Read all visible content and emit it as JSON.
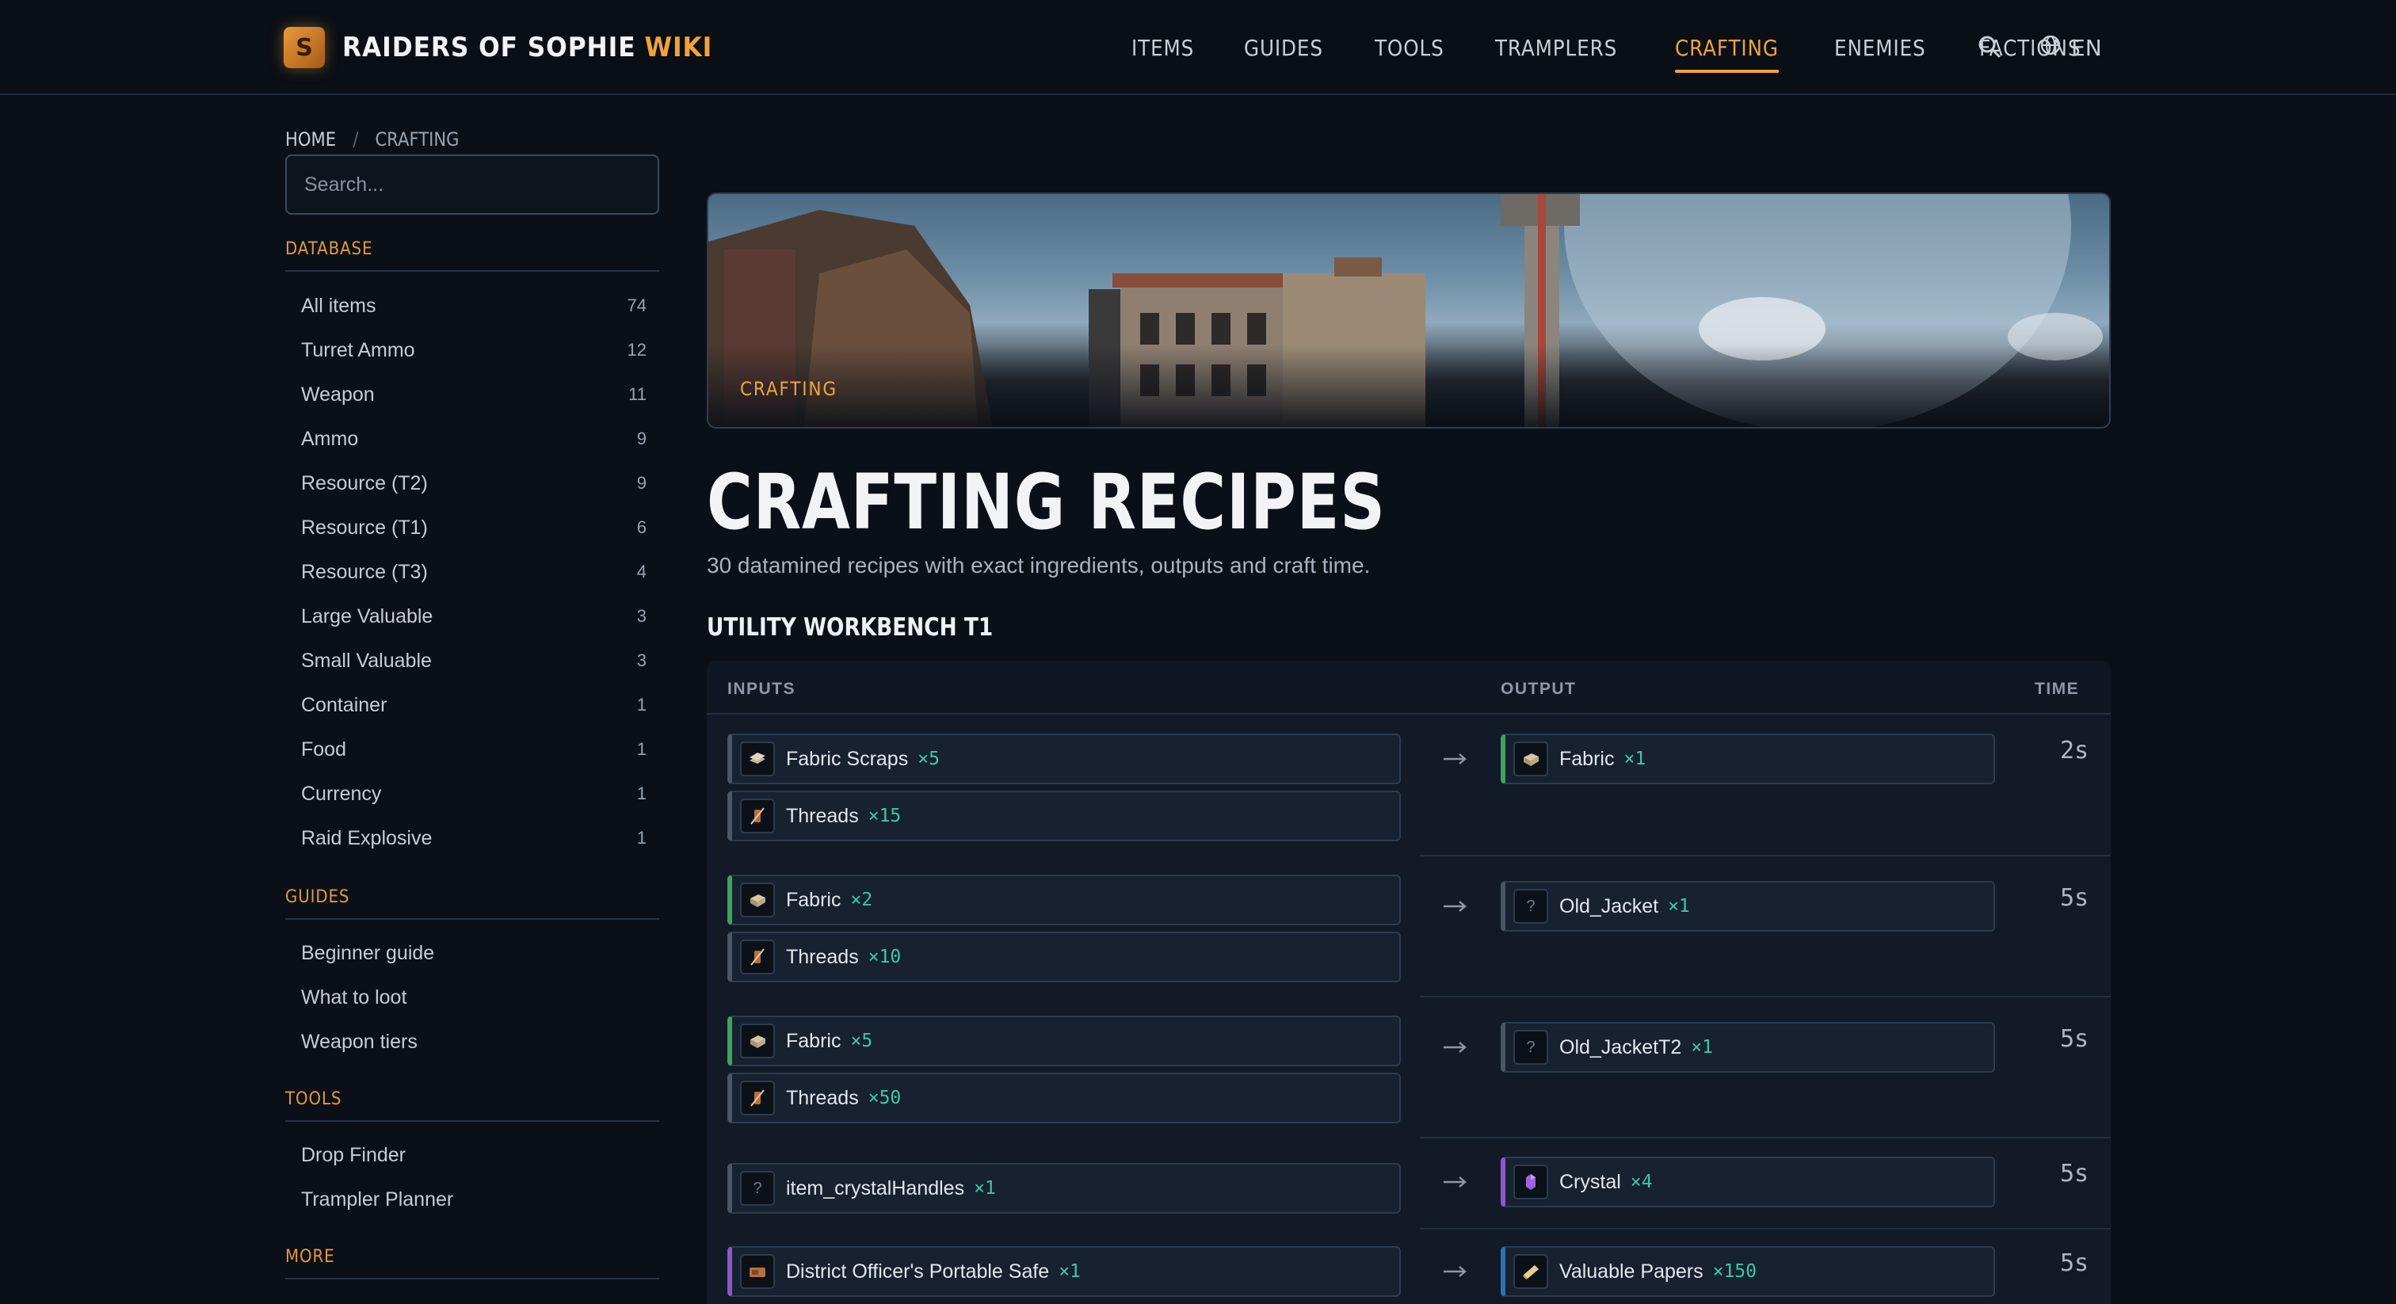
{
  "header": {
    "logo_glyph": "S",
    "logo_text": "RAIDERS OF SOPHIE",
    "logo_accent": "WIKI",
    "nav": [
      {
        "label": "ITEMS",
        "active": false
      },
      {
        "label": "GUIDES",
        "active": false
      },
      {
        "label": "TOOLS",
        "active": false
      },
      {
        "label": "TRAMPLERS",
        "active": false
      },
      {
        "label": "CRAFTING",
        "active": true
      },
      {
        "label": "ENEMIES",
        "active": false
      },
      {
        "label": "FACTIONS",
        "active": false
      }
    ],
    "search_icon": "search-icon",
    "language_icon": "globe-icon",
    "language": "EN"
  },
  "breadcrumb": {
    "home": "HOME",
    "separator": "/",
    "current": "CRAFTING"
  },
  "sidebar": {
    "search_placeholder": "Search...",
    "database_heading": "DATABASE",
    "database": [
      {
        "label": "All items",
        "count": "74"
      },
      {
        "label": "Turret Ammo",
        "count": "12"
      },
      {
        "label": "Weapon",
        "count": "11"
      },
      {
        "label": "Ammo",
        "count": "9"
      },
      {
        "label": "Resource (T2)",
        "count": "9"
      },
      {
        "label": "Resource (T1)",
        "count": "6"
      },
      {
        "label": "Resource (T3)",
        "count": "4"
      },
      {
        "label": "Large Valuable",
        "count": "3"
      },
      {
        "label": "Small Valuable",
        "count": "3"
      },
      {
        "label": "Container",
        "count": "1"
      },
      {
        "label": "Food",
        "count": "1"
      },
      {
        "label": "Currency",
        "count": "1"
      },
      {
        "label": "Raid Explosive",
        "count": "1"
      }
    ],
    "guides_heading": "GUIDES",
    "guides": [
      {
        "label": "Beginner guide"
      },
      {
        "label": "What to loot"
      },
      {
        "label": "Weapon tiers"
      }
    ],
    "tools_heading": "TOOLS",
    "tools": [
      {
        "label": "Drop Finder"
      },
      {
        "label": "Trampler Planner"
      }
    ],
    "more_heading": "MORE"
  },
  "hero": {
    "label": "CRAFTING"
  },
  "main": {
    "title": "CRAFTING RECIPES",
    "subtitle": "30 datamined recipes with exact ingredients, outputs and craft time.",
    "section": "UTILITY WORKBENCH T1",
    "columns": {
      "inputs": "INPUTS",
      "output": "OUTPUT",
      "time": "TIME"
    },
    "arrow": "→",
    "colors": {
      "accent": "#f0a33c",
      "quantity": "#3ec7a5",
      "uncommon": "#3fa35c",
      "rare": "#8a58c9",
      "epic": "#2f6fb3",
      "common": "#4a5666"
    },
    "recipes": [
      {
        "inputs": [
          {
            "name": "Fabric Scraps",
            "qty": "×5",
            "icon": "fabric-scraps-icon",
            "rarity": "common"
          },
          {
            "name": "Threads",
            "qty": "×15",
            "icon": "threads-icon",
            "rarity": "common"
          }
        ],
        "output": {
          "name": "Fabric",
          "qty": "×1",
          "icon": "fabric-icon",
          "rarity": "uncommon"
        },
        "time": "2s"
      },
      {
        "inputs": [
          {
            "name": "Fabric",
            "qty": "×2",
            "icon": "fabric-icon",
            "rarity": "uncommon"
          },
          {
            "name": "Threads",
            "qty": "×10",
            "icon": "threads-icon",
            "rarity": "common"
          }
        ],
        "output": {
          "name": "Old_Jacket",
          "qty": "×1",
          "icon": "unknown-icon",
          "rarity": "common"
        },
        "time": "5s"
      },
      {
        "inputs": [
          {
            "name": "Fabric",
            "qty": "×5",
            "icon": "fabric-icon",
            "rarity": "uncommon"
          },
          {
            "name": "Threads",
            "qty": "×50",
            "icon": "threads-icon",
            "rarity": "common"
          }
        ],
        "output": {
          "name": "Old_JacketT2",
          "qty": "×1",
          "icon": "unknown-icon",
          "rarity": "common"
        },
        "time": "5s"
      },
      {
        "inputs": [
          {
            "name": "item_crystalHandles",
            "qty": "×1",
            "icon": "unknown-icon",
            "rarity": "common"
          }
        ],
        "output": {
          "name": "Crystal",
          "qty": "×4",
          "icon": "crystal-icon",
          "rarity": "rare"
        },
        "time": "5s"
      },
      {
        "inputs": [
          {
            "name": "District Officer's Portable Safe",
            "qty": "×1",
            "icon": "safe-icon",
            "rarity": "rare"
          }
        ],
        "output": {
          "name": "Valuable Papers",
          "qty": "×150",
          "icon": "papers-icon",
          "rarity": "epic"
        },
        "time": "5s"
      }
    ]
  }
}
